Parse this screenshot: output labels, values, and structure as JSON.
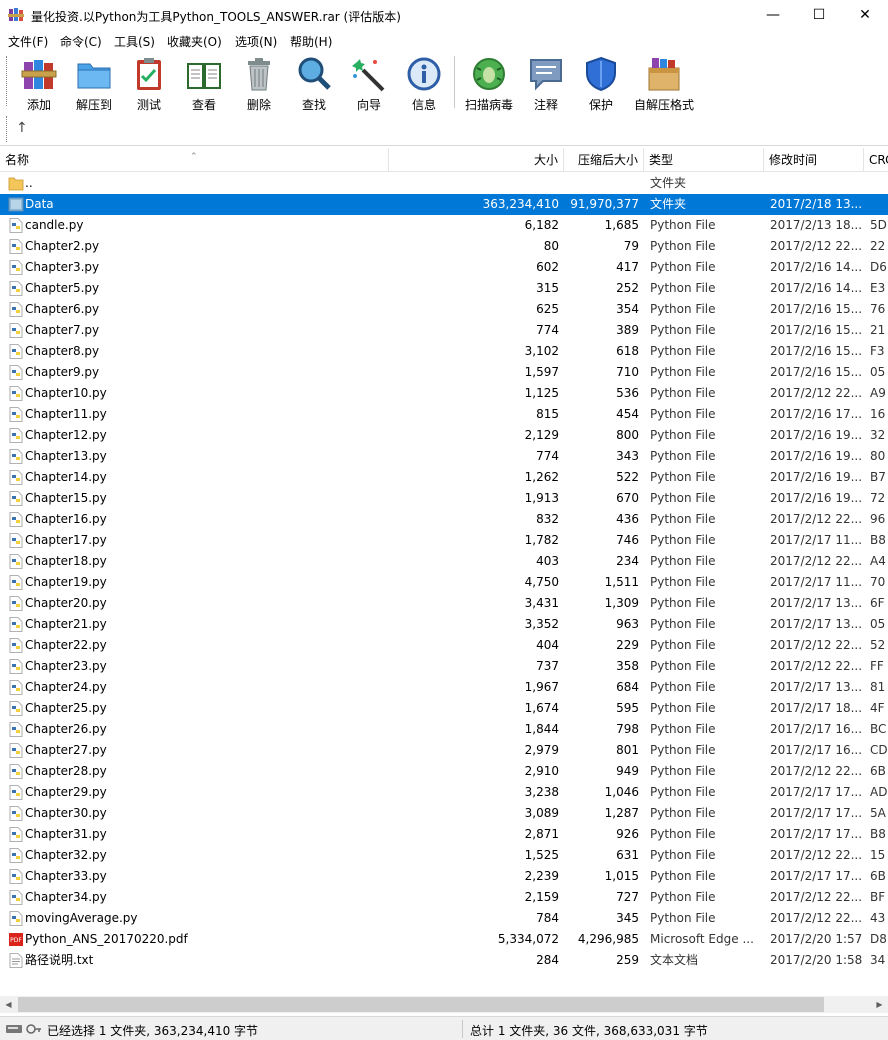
{
  "window": {
    "title": "量化投资.以Python为工具Python_TOOLS_ANSWER.rar (评估版本)",
    "minimize_glyph": "—",
    "maximize_glyph": "☐",
    "close_glyph": "✕"
  },
  "menu": [
    "文件(F)",
    "命令(C)",
    "工具(S)",
    "收藏夹(O)",
    "选项(N)",
    "帮助(H)"
  ],
  "toolbar": {
    "buttons": [
      {
        "label": "添加",
        "icon": "books-add-icon"
      },
      {
        "label": "解压到",
        "icon": "folder-extract-icon"
      },
      {
        "label": "测试",
        "icon": "clipboard-test-icon"
      },
      {
        "label": "查看",
        "icon": "open-book-view-icon"
      },
      {
        "label": "删除",
        "icon": "trash-icon"
      },
      {
        "label": "查找",
        "icon": "magnifier-icon"
      },
      {
        "label": "向导",
        "icon": "magic-wand-icon"
      },
      {
        "label": "信息",
        "icon": "info-icon"
      },
      {
        "label": "扫描病毒",
        "icon": "virus-scan-icon"
      },
      {
        "label": "注释",
        "icon": "comment-icon"
      },
      {
        "label": "保护",
        "icon": "shield-icon"
      },
      {
        "label": "自解压格式",
        "icon": "sfx-box-icon"
      }
    ],
    "up_glyph": "↑"
  },
  "columns": {
    "name": "名称",
    "size": "大小",
    "packed": "压缩后大小",
    "type": "类型",
    "modified": "修改时间",
    "crc": "CRC"
  },
  "files": [
    {
      "name": "..",
      "size": "",
      "packed": "",
      "type": "文件夹",
      "modified": "",
      "crc": "",
      "icon": "folder"
    },
    {
      "name": "Data",
      "size": "363,234,410",
      "packed": "91,970,377",
      "type": "文件夹",
      "modified": "2017/2/18 13...",
      "crc": "",
      "icon": "folder",
      "selected": true
    },
    {
      "name": "candle.py",
      "size": "6,182",
      "packed": "1,685",
      "type": "Python File",
      "modified": "2017/2/13 18...",
      "crc": "5D",
      "icon": "py"
    },
    {
      "name": "Chapter2.py",
      "size": "80",
      "packed": "79",
      "type": "Python File",
      "modified": "2017/2/12 22...",
      "crc": "22",
      "icon": "py"
    },
    {
      "name": "Chapter3.py",
      "size": "602",
      "packed": "417",
      "type": "Python File",
      "modified": "2017/2/16 14...",
      "crc": "D6",
      "icon": "py"
    },
    {
      "name": "Chapter5.py",
      "size": "315",
      "packed": "252",
      "type": "Python File",
      "modified": "2017/2/16 14...",
      "crc": "E3",
      "icon": "py"
    },
    {
      "name": "Chapter6.py",
      "size": "625",
      "packed": "354",
      "type": "Python File",
      "modified": "2017/2/16 15...",
      "crc": "76",
      "icon": "py"
    },
    {
      "name": "Chapter7.py",
      "size": "774",
      "packed": "389",
      "type": "Python File",
      "modified": "2017/2/16 15...",
      "crc": "21",
      "icon": "py"
    },
    {
      "name": "Chapter8.py",
      "size": "3,102",
      "packed": "618",
      "type": "Python File",
      "modified": "2017/2/16 15...",
      "crc": "F3",
      "icon": "py"
    },
    {
      "name": "Chapter9.py",
      "size": "1,597",
      "packed": "710",
      "type": "Python File",
      "modified": "2017/2/16 15...",
      "crc": "05",
      "icon": "py"
    },
    {
      "name": "Chapter10.py",
      "size": "1,125",
      "packed": "536",
      "type": "Python File",
      "modified": "2017/2/12 22...",
      "crc": "A9",
      "icon": "py"
    },
    {
      "name": "Chapter11.py",
      "size": "815",
      "packed": "454",
      "type": "Python File",
      "modified": "2017/2/16 17...",
      "crc": "16",
      "icon": "py"
    },
    {
      "name": "Chapter12.py",
      "size": "2,129",
      "packed": "800",
      "type": "Python File",
      "modified": "2017/2/16 19...",
      "crc": "32",
      "icon": "py"
    },
    {
      "name": "Chapter13.py",
      "size": "774",
      "packed": "343",
      "type": "Python File",
      "modified": "2017/2/16 19...",
      "crc": "80",
      "icon": "py"
    },
    {
      "name": "Chapter14.py",
      "size": "1,262",
      "packed": "522",
      "type": "Python File",
      "modified": "2017/2/16 19...",
      "crc": "B7",
      "icon": "py"
    },
    {
      "name": "Chapter15.py",
      "size": "1,913",
      "packed": "670",
      "type": "Python File",
      "modified": "2017/2/16 19...",
      "crc": "72",
      "icon": "py"
    },
    {
      "name": "Chapter16.py",
      "size": "832",
      "packed": "436",
      "type": "Python File",
      "modified": "2017/2/12 22...",
      "crc": "96",
      "icon": "py"
    },
    {
      "name": "Chapter17.py",
      "size": "1,782",
      "packed": "746",
      "type": "Python File",
      "modified": "2017/2/17 11...",
      "crc": "B8",
      "icon": "py"
    },
    {
      "name": "Chapter18.py",
      "size": "403",
      "packed": "234",
      "type": "Python File",
      "modified": "2017/2/12 22...",
      "crc": "A4",
      "icon": "py"
    },
    {
      "name": "Chapter19.py",
      "size": "4,750",
      "packed": "1,511",
      "type": "Python File",
      "modified": "2017/2/17 11...",
      "crc": "70",
      "icon": "py"
    },
    {
      "name": "Chapter20.py",
      "size": "3,431",
      "packed": "1,309",
      "type": "Python File",
      "modified": "2017/2/17 13...",
      "crc": "6F",
      "icon": "py"
    },
    {
      "name": "Chapter21.py",
      "size": "3,352",
      "packed": "963",
      "type": "Python File",
      "modified": "2017/2/17 13...",
      "crc": "05",
      "icon": "py"
    },
    {
      "name": "Chapter22.py",
      "size": "404",
      "packed": "229",
      "type": "Python File",
      "modified": "2017/2/12 22...",
      "crc": "52",
      "icon": "py"
    },
    {
      "name": "Chapter23.py",
      "size": "737",
      "packed": "358",
      "type": "Python File",
      "modified": "2017/2/12 22...",
      "crc": "FF",
      "icon": "py"
    },
    {
      "name": "Chapter24.py",
      "size": "1,967",
      "packed": "684",
      "type": "Python File",
      "modified": "2017/2/17 13...",
      "crc": "81",
      "icon": "py"
    },
    {
      "name": "Chapter25.py",
      "size": "1,674",
      "packed": "595",
      "type": "Python File",
      "modified": "2017/2/17 18...",
      "crc": "4F",
      "icon": "py"
    },
    {
      "name": "Chapter26.py",
      "size": "1,844",
      "packed": "798",
      "type": "Python File",
      "modified": "2017/2/17 16...",
      "crc": "BC",
      "icon": "py"
    },
    {
      "name": "Chapter27.py",
      "size": "2,979",
      "packed": "801",
      "type": "Python File",
      "modified": "2017/2/17 16...",
      "crc": "CD",
      "icon": "py"
    },
    {
      "name": "Chapter28.py",
      "size": "2,910",
      "packed": "949",
      "type": "Python File",
      "modified": "2017/2/12 22...",
      "crc": "6B",
      "icon": "py"
    },
    {
      "name": "Chapter29.py",
      "size": "3,238",
      "packed": "1,046",
      "type": "Python File",
      "modified": "2017/2/17 17...",
      "crc": "AD",
      "icon": "py"
    },
    {
      "name": "Chapter30.py",
      "size": "3,089",
      "packed": "1,287",
      "type": "Python File",
      "modified": "2017/2/17 17...",
      "crc": "5A",
      "icon": "py"
    },
    {
      "name": "Chapter31.py",
      "size": "2,871",
      "packed": "926",
      "type": "Python File",
      "modified": "2017/2/17 17...",
      "crc": "B8",
      "icon": "py"
    },
    {
      "name": "Chapter32.py",
      "size": "1,525",
      "packed": "631",
      "type": "Python File",
      "modified": "2017/2/12 22...",
      "crc": "15",
      "icon": "py"
    },
    {
      "name": "Chapter33.py",
      "size": "2,239",
      "packed": "1,015",
      "type": "Python File",
      "modified": "2017/2/17 17...",
      "crc": "6B",
      "icon": "py"
    },
    {
      "name": "Chapter34.py",
      "size": "2,159",
      "packed": "727",
      "type": "Python File",
      "modified": "2017/2/12 22...",
      "crc": "BF",
      "icon": "py"
    },
    {
      "name": "movingAverage.py",
      "size": "784",
      "packed": "345",
      "type": "Python File",
      "modified": "2017/2/12 22...",
      "crc": "43",
      "icon": "py"
    },
    {
      "name": "Python_ANS_20170220.pdf",
      "size": "5,334,072",
      "packed": "4,296,985",
      "type": "Microsoft Edge ...",
      "modified": "2017/2/20 1:57",
      "crc": "D8",
      "icon": "pdf"
    },
    {
      "name": "路径说明.txt",
      "size": "284",
      "packed": "259",
      "type": "文本文档",
      "modified": "2017/2/20 1:58",
      "crc": "34",
      "icon": "txt"
    }
  ],
  "status": {
    "left": "已经选择 1 文件夹, 363,234,410 字节",
    "right": "总计 1 文件夹, 36 文件, 368,633,031 字节"
  },
  "colors": {
    "selection": "#0078d7",
    "folder": "#f3c65a",
    "python_blue": "#3a74b0",
    "python_yellow": "#f4d03f",
    "pdf_red": "#d9241c"
  }
}
